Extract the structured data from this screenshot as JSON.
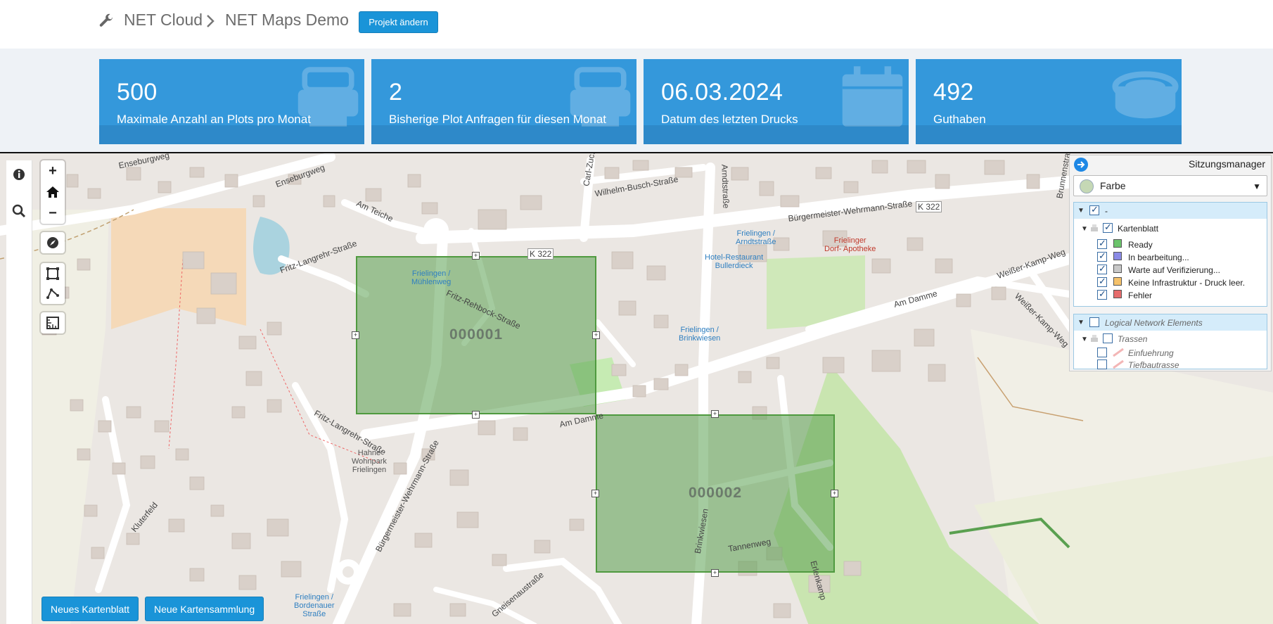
{
  "header": {
    "breadcrumb_root": "NET Cloud",
    "breadcrumb_project": "NET Maps Demo",
    "change_project_button": "Projekt ändern"
  },
  "stats": [
    {
      "value": "500",
      "label": "Maximale Anzahl an Plots pro Monat",
      "icon": "printer-icon"
    },
    {
      "value": "2",
      "label": "Bisherige Plot Anfragen für diesen Monat",
      "icon": "printer-icon"
    },
    {
      "value": "06.03.2024",
      "label": "Datum des letzten Drucks",
      "icon": "calendar-icon"
    },
    {
      "value": "492",
      "label": "Guthaben",
      "icon": "coins-icon"
    }
  ],
  "map": {
    "zoom_in": "+",
    "zoom_out": "−",
    "plots": [
      {
        "id": "000001"
      },
      {
        "id": "000002"
      }
    ],
    "labels": {
      "enseburgweg": "Enseburgweg",
      "enseburgweg2": "Enseburgweg",
      "am_teiche": "Am Teiche",
      "fritz_langrehr": "Fritz-Langrehr-Straße",
      "fritz_langrehr2": "Fritz-Langrehr-Straße",
      "fritz_rehbock": "Fritz-Rehbock-Straße",
      "k322a": "K 322",
      "k322b": "K 322",
      "wilhelm_busch": "Wilhelm-Busch-Straße",
      "arndtstrasse": "Arndtstraße",
      "buergermeister": "Bürgermeister-Wehrmann-Straße",
      "buergermeister2": "Bürgermeister-Wehrmann-Straße",
      "am_damme": "Am Damme",
      "am_damme2": "Am Damme",
      "weisser_kamp": "Weißer-Kamp-Weg",
      "weisser_kamp2": "Weißer-Kamp-Weg",
      "brinkwiesen": "Brinkwiesen",
      "tannenweg": "Tannenweg",
      "erlenkamp": "Erlenkamp",
      "kluterfeld": "Kluterfeld",
      "gneisenaustrasse": "Gneisenaustraße",
      "carl_zuckmayer": "Carl-Zuc...",
      "brunnenstrasse": "Brunnenstra...",
      "hahne": "Hahne\nWohnpark\nFrielingen",
      "stop_muehlenweg": "Frielingen /\nMühlenweg",
      "stop_arndtstrasse": "Frielingen /\nArndtstraße",
      "stop_brinkwiesen": "Frielingen /\nBrinkwiesen",
      "stop_bordenauer": "Frielingen /\nBordenauer\nStraße",
      "hotel": "Hotel-Restaurant\nBullerdieck",
      "apotheke": "Frielinger\nDorf- Apotheke"
    }
  },
  "session_manager": {
    "title": "Sitzungsmanager",
    "style_select": "Farbe",
    "group1": {
      "title": "-",
      "layer": "Kartenblatt",
      "items": [
        {
          "label": "Ready",
          "color": "#6cc46c"
        },
        {
          "label": "In bearbeitung...",
          "color": "#8a8ae6"
        },
        {
          "label": "Warte auf Verifizierung...",
          "color": "#c8c8c8"
        },
        {
          "label": "Keine Infrastruktur - Druck leer.",
          "color": "#f5c26b"
        },
        {
          "label": "Fehler",
          "color": "#e66c6c"
        }
      ]
    },
    "group2": {
      "title": "Logical Network Elements",
      "layer": "Trassen",
      "items": [
        {
          "label": "Einfuehrung"
        },
        {
          "label": "Tiefbautrasse"
        }
      ]
    }
  },
  "buttons": {
    "new_sheet": "Neues Kartenblatt",
    "new_collection": "Neue Kartensammlung"
  },
  "colors": {
    "accent": "#1a94d8",
    "card": "#3498db",
    "plot_fill": "#5aa050"
  }
}
